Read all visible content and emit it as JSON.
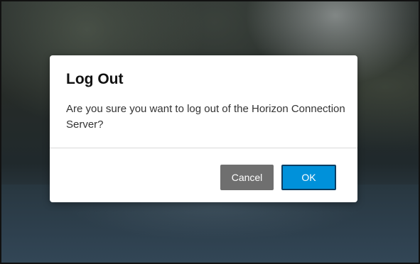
{
  "dialog": {
    "title": "Log Out",
    "message": "Are you sure you want to log out of the Horizon Connection Server?",
    "buttons": {
      "cancel_label": "Cancel",
      "ok_label": "OK"
    }
  },
  "colors": {
    "ok_button": "#0091da",
    "cancel_button": "#6f6f6f",
    "dialog_background": "#ffffff"
  }
}
